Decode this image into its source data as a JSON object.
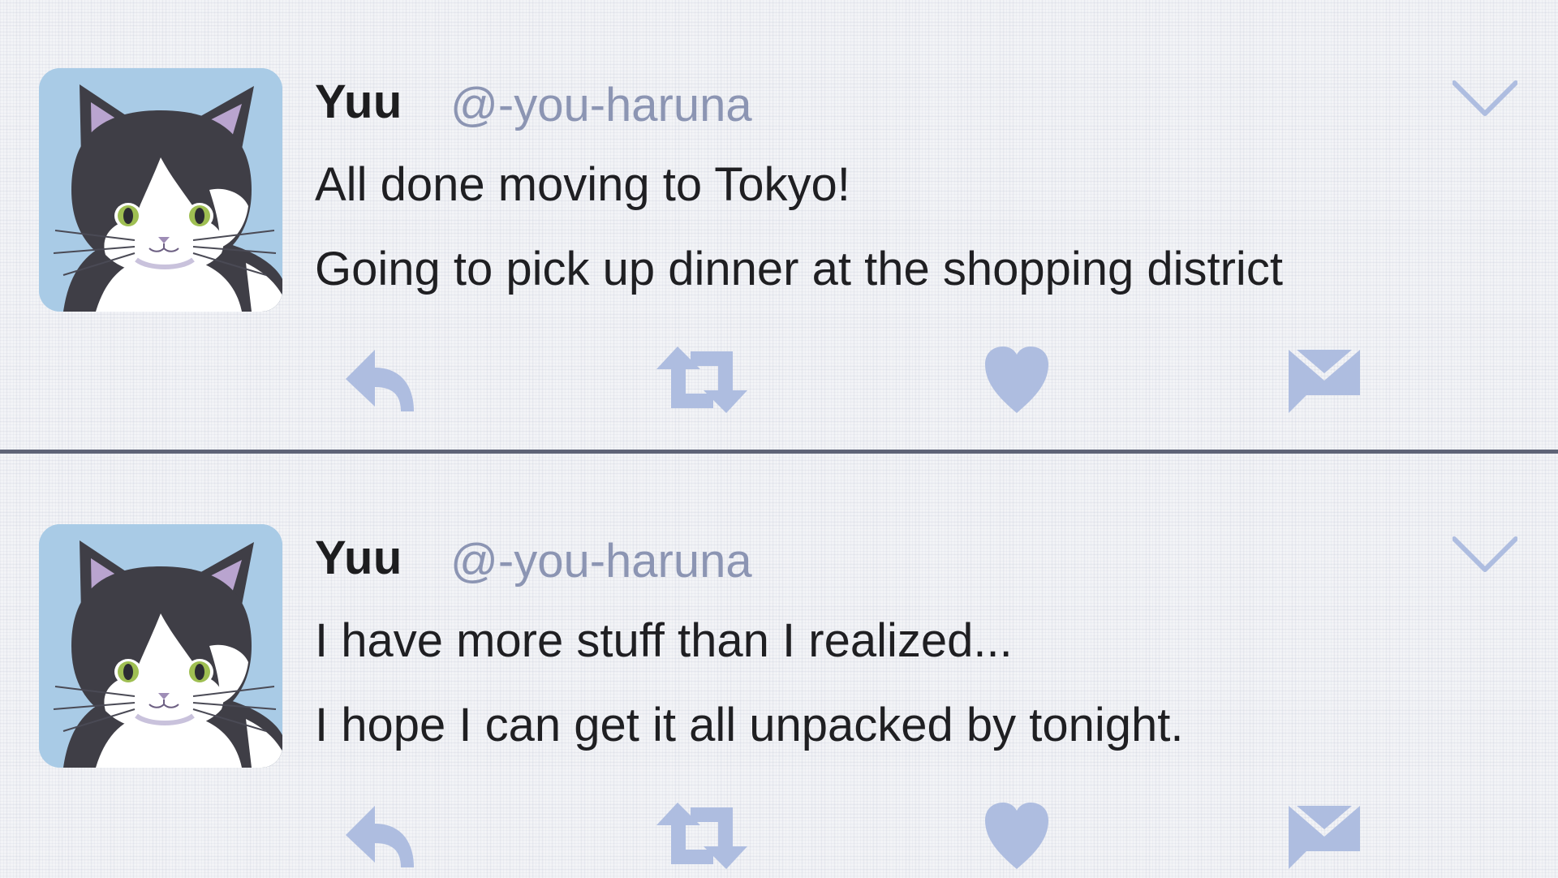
{
  "colors": {
    "background": "#f3f4f7",
    "name": "#1d1d1f",
    "handle": "#8c95b3",
    "text": "#1f1f22",
    "icon": "#aebde0",
    "divider": "#5f6477",
    "avatar_bg": "#a9cbe6"
  },
  "tweets": [
    {
      "name": "Yuu",
      "handle": "@-you-haruna",
      "lines": [
        "All done moving to Tokyo!",
        "Going to pick up dinner at the shopping district"
      ],
      "icons": [
        "reply-icon",
        "retweet-icon",
        "like-icon",
        "message-icon",
        "chevron-down-icon"
      ]
    },
    {
      "name": "Yuu",
      "handle": "@-you-haruna",
      "lines": [
        "I have more stuff than I realized...",
        "I hope I can get it all unpacked by tonight."
      ],
      "icons": [
        "reply-icon",
        "retweet-icon",
        "like-icon",
        "message-icon",
        "chevron-down-icon"
      ]
    }
  ]
}
